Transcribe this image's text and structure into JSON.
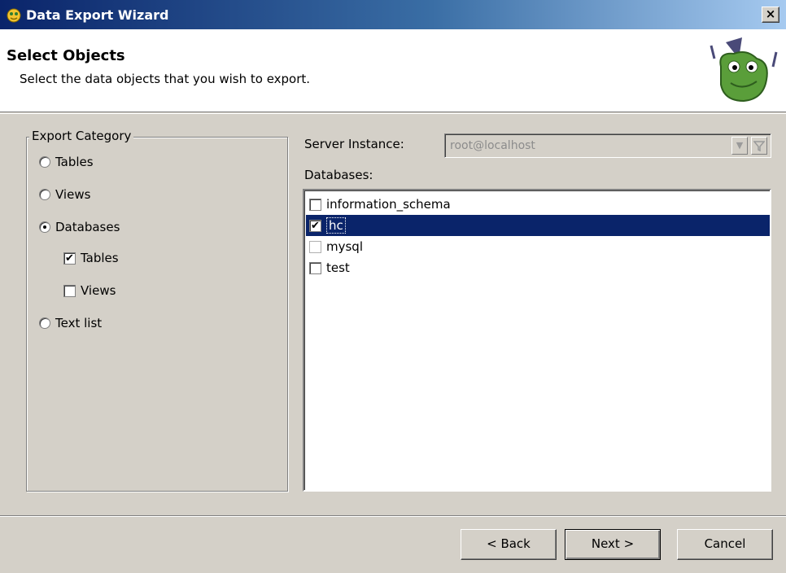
{
  "window": {
    "title": "Data Export Wizard",
    "close_label": "×"
  },
  "header": {
    "title": "Select Objects",
    "subtitle": "Select the data objects that you wish to export."
  },
  "export_category": {
    "legend": "Export Category",
    "options": [
      {
        "label": "Tables",
        "selected": false
      },
      {
        "label": "Views",
        "selected": false
      },
      {
        "label": "Databases",
        "selected": true
      },
      {
        "label": "Text list",
        "selected": false
      }
    ],
    "database_suboptions": [
      {
        "label": "Tables",
        "checked": true
      },
      {
        "label": "Views",
        "checked": false
      }
    ]
  },
  "server": {
    "label": "Server Instance:",
    "value": "root@localhost"
  },
  "databases": {
    "label": "Databases:",
    "items": [
      {
        "label": "information_schema",
        "checked": false,
        "selected": false
      },
      {
        "label": "hc",
        "checked": true,
        "selected": true
      },
      {
        "label": "mysql",
        "checked": false,
        "selected": false
      },
      {
        "label": "test",
        "checked": false,
        "selected": false
      }
    ]
  },
  "buttons": {
    "back": "< Back",
    "next": "Next >",
    "cancel": "Cancel"
  },
  "icons": {
    "title": "frog-icon",
    "header": "frog-mascot-logo"
  }
}
